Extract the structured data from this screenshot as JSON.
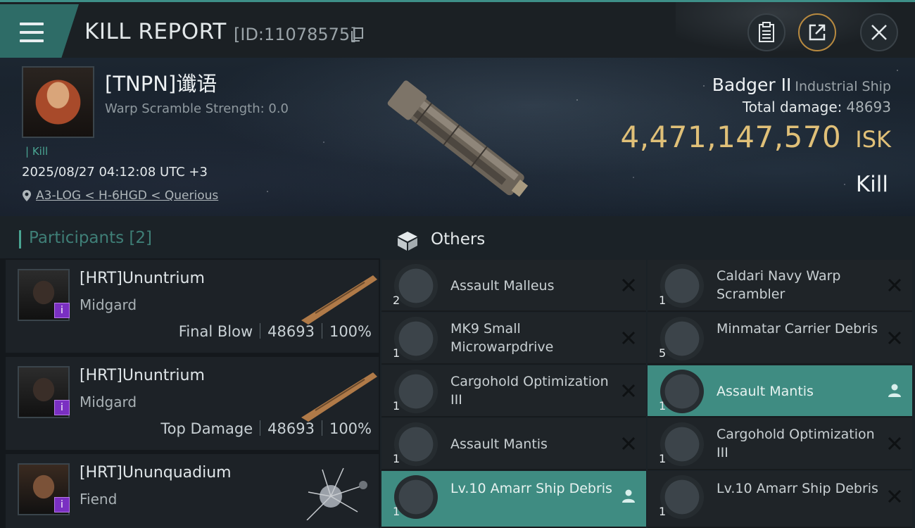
{
  "header": {
    "title": "KILL REPORT",
    "report_id": "[ID:11078575]"
  },
  "victim": {
    "name": "[TNPN]谶语",
    "warp_scramble": "Warp Scramble Strength: 0.0",
    "kill_tag": "Kill",
    "datetime": "2025/08/27 04:12:08 UTC +3",
    "location": "A3-LOG < H-6HGD < Querious"
  },
  "ship": {
    "name": "Badger II",
    "class": "Industrial Ship",
    "total_damage_label": "Total damage:",
    "total_damage": "48693",
    "isk_value": "4,471,147,570",
    "isk_unit": "ISK",
    "status": "Kill"
  },
  "participants": {
    "title": "Participants",
    "count": "[2]",
    "rows": [
      {
        "name": "[HRT]Ununtrium",
        "ship": "Midgard",
        "role": "Final Blow",
        "damage": "48693",
        "percent": "100%"
      },
      {
        "name": "[HRT]Ununtrium",
        "ship": "Midgard",
        "role": "Top Damage",
        "damage": "48693",
        "percent": "100%"
      },
      {
        "name": "[HRT]Ununquadium",
        "ship": "Fiend"
      }
    ]
  },
  "others": {
    "title": "Others",
    "items": [
      {
        "qty": "2",
        "name": "Assault Malleus",
        "action": "destroyed"
      },
      {
        "qty": "1",
        "name": "Caldari Navy Warp Scrambler",
        "action": "destroyed"
      },
      {
        "qty": "1",
        "name": "MK9 Small Microwarpdrive",
        "action": "destroyed"
      },
      {
        "qty": "5",
        "name": "Minmatar Carrier Debris",
        "action": "destroyed"
      },
      {
        "qty": "1",
        "name": "Cargohold Optimization III",
        "action": "destroyed"
      },
      {
        "qty": "1",
        "name": "Assault Mantis",
        "action": "dropped"
      },
      {
        "qty": "1",
        "name": "Assault Mantis",
        "action": "destroyed"
      },
      {
        "qty": "1",
        "name": "Cargohold Optimization III",
        "action": "destroyed"
      },
      {
        "qty": "1",
        "name": "Lv.10 Amarr Ship Debris",
        "action": "dropped"
      },
      {
        "qty": "1",
        "name": "Lv.10 Amarr Ship Debris",
        "action": "destroyed"
      }
    ]
  },
  "colors": {
    "accent": "#3f8c82",
    "isk": "#e0c078",
    "badge": "#7a2fc2"
  }
}
